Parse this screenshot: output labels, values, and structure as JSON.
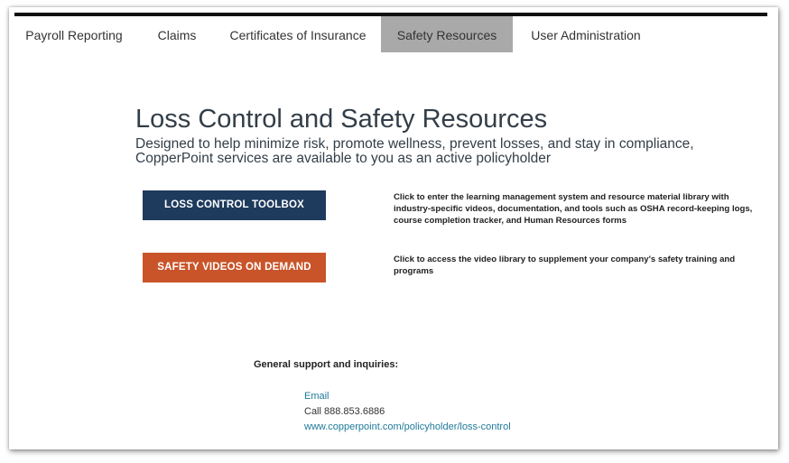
{
  "nav": {
    "tabs": [
      {
        "label": "Payroll Reporting"
      },
      {
        "label": "Claims"
      },
      {
        "label": "Certificates of Insurance"
      },
      {
        "label": "Safety Resources"
      },
      {
        "label": "User Administration"
      }
    ],
    "active_tab": "Safety Resources"
  },
  "main": {
    "title": "Loss Control and Safety Resources",
    "subtitle": "Designed to help minimize risk, promote wellness, prevent losses, and stay in compliance, CopperPoint services are available to you as an active policyholder"
  },
  "resources": [
    {
      "button_label": "LOSS CONTROL TOOLBOX",
      "button_color": "#1e3a5c",
      "description": "Click to enter the learning management system and resource material library with industry-specific videos, documentation, and tools such as OSHA record-keeping logs, course completion tracker, and Human Resources forms"
    },
    {
      "button_label": "SAFETY VIDEOS ON DEMAND",
      "button_color": "#c9542a",
      "description": "Click to access the video library to supplement your company's safety training and programs"
    }
  ],
  "support": {
    "heading": "General support and inquiries:",
    "email_label": "Email",
    "phone": "Call 888.853.6886",
    "website": "www.copperpoint.com/policyholder/loss-control"
  }
}
